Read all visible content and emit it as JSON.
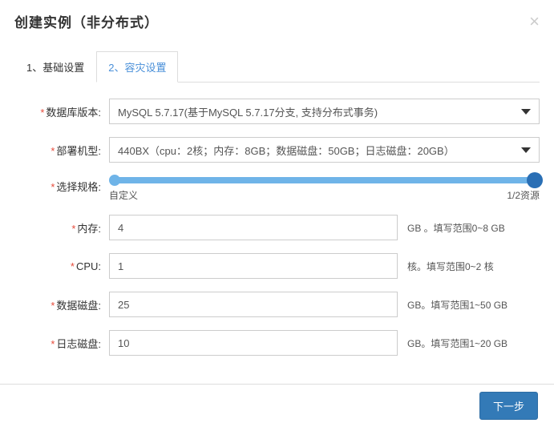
{
  "header": {
    "title": "创建实例（非分布式）"
  },
  "tabs": [
    {
      "label": "1、基础设置"
    },
    {
      "label": "2、容灾设置"
    }
  ],
  "form": {
    "db_version": {
      "label": "数据库版本:",
      "value": "MySQL 5.7.17(基于MySQL 5.7.17分支, 支持分布式事务)"
    },
    "machine_type": {
      "label": "部署机型:",
      "value": "440BX（cpu：2核；内存：8GB；数据磁盘：50GB；日志磁盘：20GB）"
    },
    "spec": {
      "label": "选择规格:",
      "left": "自定义",
      "right": "1/2资源"
    },
    "memory": {
      "label": "内存:",
      "value": "4",
      "hint": "GB 。填写范围0~8 GB"
    },
    "cpu": {
      "label": "CPU:",
      "value": "1",
      "hint": "核。填写范围0~2 核"
    },
    "data_disk": {
      "label": "数据磁盘:",
      "value": "25",
      "hint": "GB。填写范围1~50 GB"
    },
    "log_disk": {
      "label": "日志磁盘:",
      "value": "10",
      "hint": "GB。填写范围1~20 GB"
    }
  },
  "footer": {
    "next": "下一步"
  }
}
